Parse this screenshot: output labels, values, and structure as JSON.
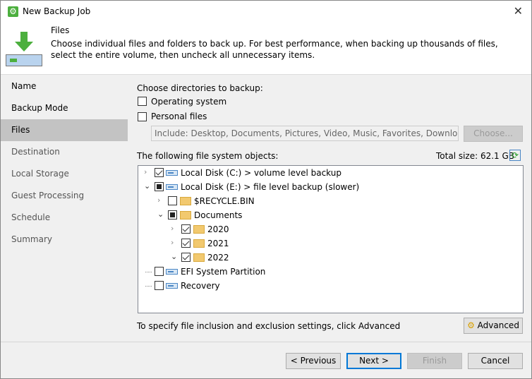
{
  "window": {
    "title": "New Backup Job",
    "close": "✕"
  },
  "header": {
    "title": "Files",
    "description": "Choose individual files and folders to back up. For best performance, when backing up thousands of files, select the entire volume, then uncheck all unnecessary items."
  },
  "sidebar": {
    "items": [
      {
        "label": "Name"
      },
      {
        "label": "Backup Mode"
      },
      {
        "label": "Files"
      },
      {
        "label": "Destination"
      },
      {
        "label": "Local Storage"
      },
      {
        "label": "Guest Processing"
      },
      {
        "label": "Schedule"
      },
      {
        "label": "Summary"
      }
    ]
  },
  "main": {
    "choose_label": "Choose directories to backup:",
    "os_label": "Operating system",
    "personal_label": "Personal files",
    "include_value": "Include: Desktop, Documents, Pictures, Video, Music, Favorites, Downloads, Other",
    "choose_button": "Choose...",
    "objects_label": "The following file system objects:",
    "total_size": "Total size:  62.1 GB",
    "tree": [
      {
        "label": "Local Disk (C:) > volume level backup",
        "level": 0,
        "state": "checked",
        "icon": "windows-drive",
        "expander": "collapsed"
      },
      {
        "label": "Local Disk (E:) > file level backup (slower)",
        "level": 0,
        "state": "partial",
        "icon": "drive",
        "expander": "expanded"
      },
      {
        "label": "$RECYCLE.BIN",
        "level": 1,
        "state": "unchecked",
        "icon": "folder",
        "expander": "collapsed"
      },
      {
        "label": "Documents",
        "level": 1,
        "state": "partial",
        "icon": "folder-open",
        "expander": "expanded"
      },
      {
        "label": "2020",
        "level": 2,
        "state": "checked",
        "icon": "folder",
        "expander": "collapsed"
      },
      {
        "label": "2021",
        "level": 2,
        "state": "checked",
        "icon": "folder",
        "expander": "collapsed"
      },
      {
        "label": "2022",
        "level": 2,
        "state": "checked",
        "icon": "folder",
        "expander": "expanded"
      },
      {
        "label": "EFI System Partition",
        "level": 0,
        "state": "unchecked",
        "icon": "drive",
        "expander": "none"
      },
      {
        "label": "Recovery",
        "level": 0,
        "state": "unchecked",
        "icon": "drive",
        "expander": "none"
      }
    ],
    "hint": "To specify file inclusion and exclusion settings, click Advanced",
    "advanced_button": "Advanced"
  },
  "footer": {
    "previous": "< Previous",
    "next": "Next >",
    "finish": "Finish",
    "cancel": "Cancel"
  }
}
